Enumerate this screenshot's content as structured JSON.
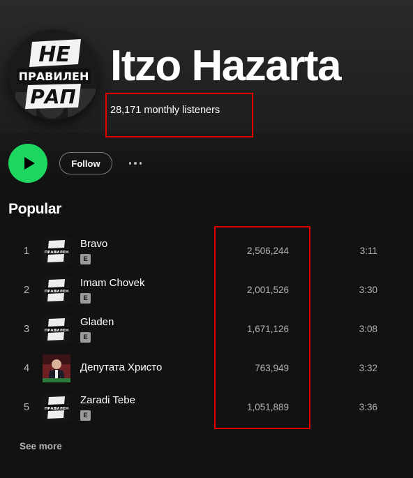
{
  "artist": {
    "name": "Itzo Hazarta",
    "monthly_listeners": "28,171 monthly listeners",
    "avatar_text": "НЕ ПРАВИЛЕН РАП"
  },
  "actions": {
    "play_icon": "play-icon",
    "follow_label": "Follow",
    "more_icon": "more-options-icon"
  },
  "popular": {
    "title": "Popular",
    "see_more_label": "See more",
    "tracks": [
      {
        "rank": "1",
        "title": "Bravo",
        "explicit": "E",
        "plays": "2,506,244",
        "duration": "3:11",
        "cover": "ne-praviлен-rap-cover"
      },
      {
        "rank": "2",
        "title": "Imam Chovek",
        "explicit": "E",
        "plays": "2,001,526",
        "duration": "3:30",
        "cover": "ne-pravilen-rap-cover"
      },
      {
        "rank": "3",
        "title": "Gladen",
        "explicit": "E",
        "plays": "1,671,126",
        "duration": "3:08",
        "cover": "ne-pravilen-rap-cover"
      },
      {
        "rank": "4",
        "title": "Депутата Христо",
        "explicit": null,
        "plays": "763,949",
        "duration": "3:32",
        "cover": "politician-portrait-cover"
      },
      {
        "rank": "5",
        "title": "Zaradi Tebe",
        "explicit": "E",
        "plays": "1,051,889",
        "duration": "3:36",
        "cover": "ne-pravilen-rap-cover"
      }
    ]
  },
  "colors": {
    "accent_green": "#1ed760",
    "background": "#121212",
    "highlight_box": "#e00000",
    "secondary_text": "#b3b3b3"
  }
}
